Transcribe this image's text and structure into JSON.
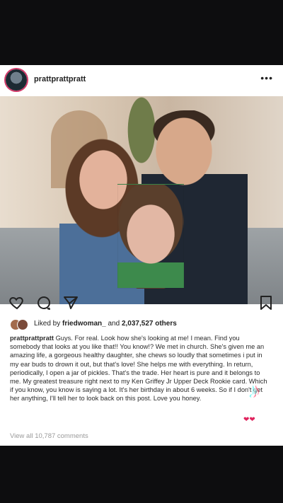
{
  "post": {
    "username": "prattprattpratt",
    "more_label": "•••",
    "likes": {
      "prefix": "Liked by ",
      "liker": "friedwoman_",
      "middle": " and ",
      "count": "2,037,527 others"
    },
    "caption_user": "prattprattpratt",
    "caption_text": "Guys. For real. Look how she's looking at me! I mean. Find you somebody that looks at you like that!! You know!? We met in church. She's given me an amazing life, a gorgeous healthy daughter, she chews so loudly that sometimes i put in my ear buds to drown it out, but that's love! She helps me with everything. In return, periodically, I open a jar of pickles. That's the trade. Her heart is pure and it belongs to me. My greatest treasure right next to my Ken Griffey Jr Upper Deck Rookie card. Which if you know, you know is saying a lot. It's her birthday in about 6 weeks. So if I don't get her anything, I'll tell her to look back on this post. Love you honey.",
    "view_all": "View all 10,787 comments",
    "icons": [
      "heart-icon",
      "comment-icon",
      "share-icon",
      "bookmark-icon"
    ]
  },
  "overlay": {
    "tiktok_glyph": "♪",
    "hearts": "❤❤"
  },
  "colors": {
    "background": "#0d0d0f",
    "post_bg": "#ffffff",
    "text": "#222222",
    "muted": "#9a9a9a",
    "story_ring": "#d33a6a"
  }
}
